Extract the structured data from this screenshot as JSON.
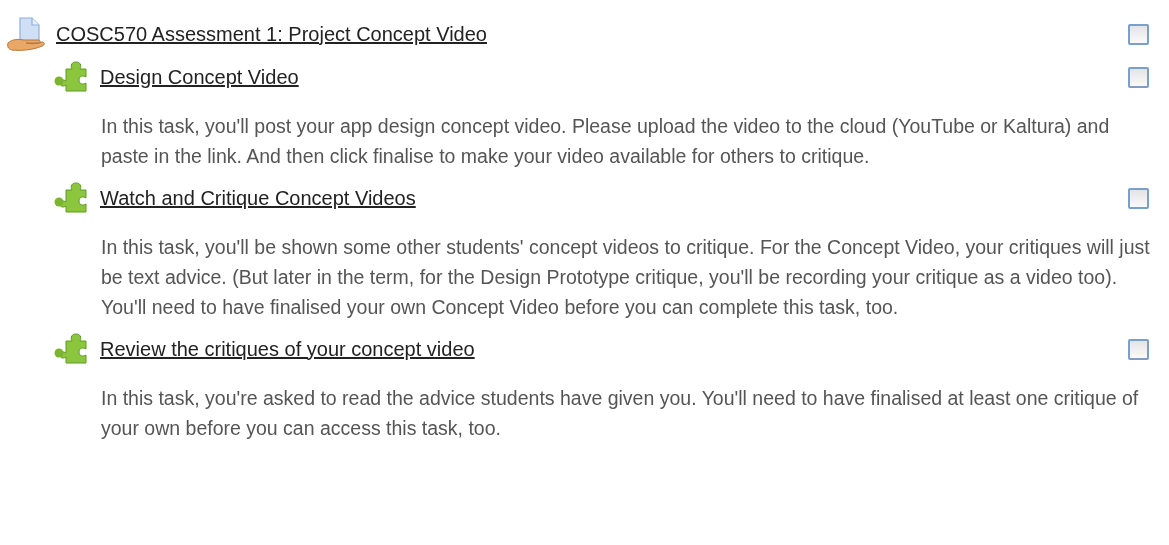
{
  "assignment": {
    "title": "COSC570 Assessment 1: Project Concept Video",
    "checked": false
  },
  "activities": [
    {
      "title": "Design Concept Video",
      "checked": false,
      "description": "In this task, you'll post your app design concept video. Please upload the video to the cloud (YouTube or Kaltura) and paste in the link. And then click finalise to make your video available for others to critique."
    },
    {
      "title": "Watch and Critique Concept Videos",
      "checked": false,
      "description": "In this task, you'll be shown some other students' concept videos to critique. For the Concept Video, your critiques will just be text advice. (But later in the term, for the Design Prototype critique, you'll be recording your critique as a video too). You'll need to have finalised your own Concept Video before you can complete this task, too."
    },
    {
      "title": "Review the critiques of your concept video",
      "checked": false,
      "description": "In this task, you're asked to read the advice students have given you. You'll need to have finalised at least one critique of your own before you can access this task, too."
    }
  ]
}
